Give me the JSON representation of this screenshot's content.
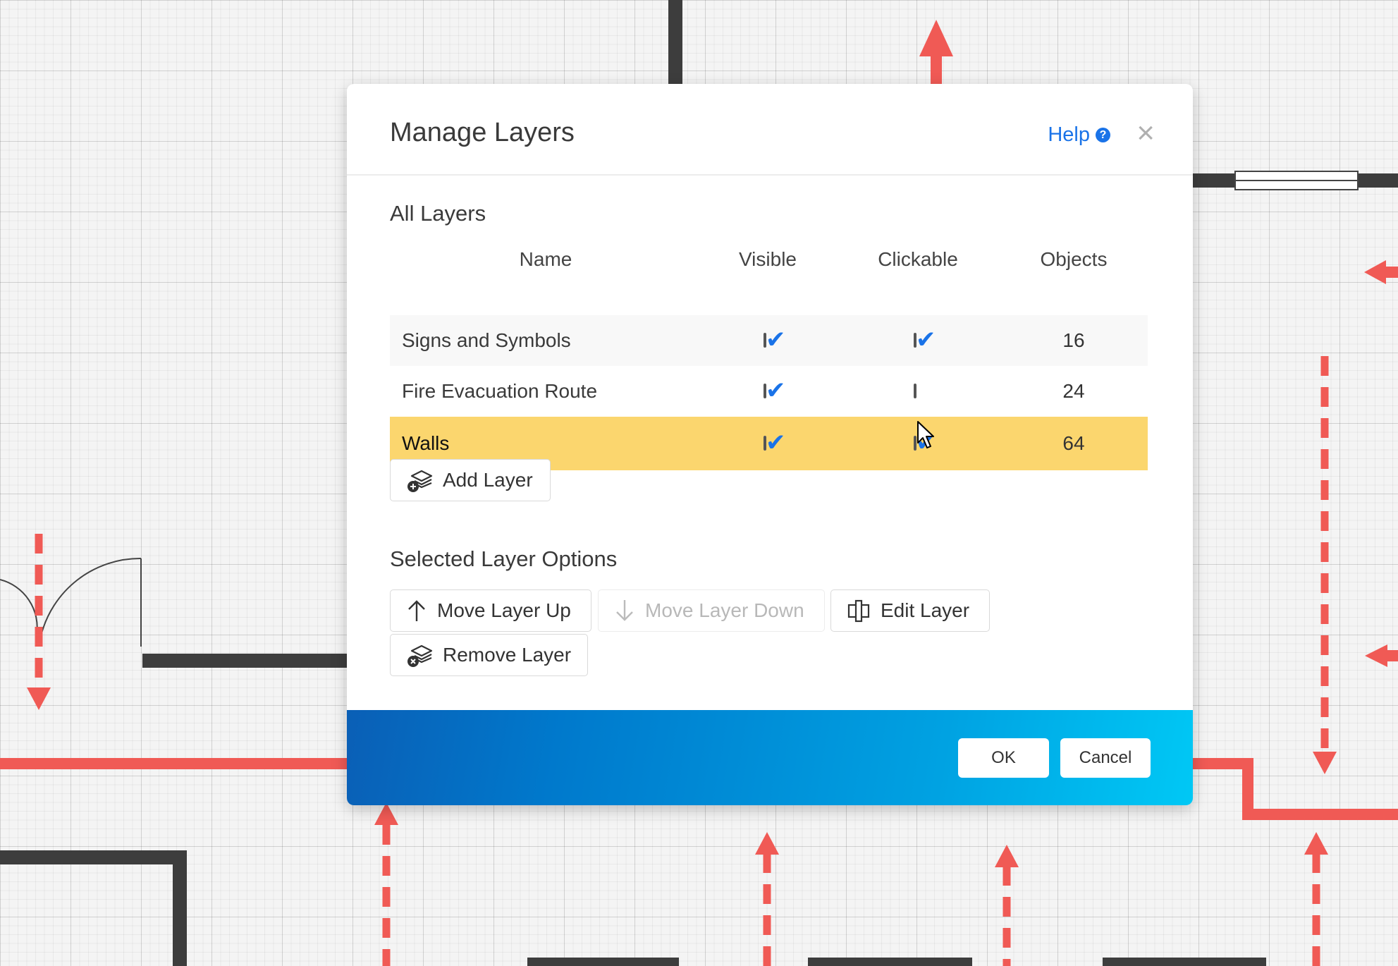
{
  "dialog": {
    "title": "Manage Layers",
    "help_label": "Help",
    "close_symbol": "×"
  },
  "all_layers": {
    "heading": "All Layers",
    "columns": [
      "Name",
      "Visible",
      "Clickable",
      "Objects"
    ],
    "rows": [
      {
        "name": "Signs and Symbols",
        "visible": true,
        "clickable": true,
        "objects": "16",
        "selected": false
      },
      {
        "name": "Fire Evacuation Route",
        "visible": true,
        "clickable": false,
        "objects": "24",
        "selected": false
      },
      {
        "name": "Walls",
        "visible": true,
        "clickable": true,
        "objects": "64",
        "selected": true
      }
    ],
    "add_layer_label": "Add Layer"
  },
  "selected_options": {
    "heading": "Selected Layer Options",
    "move_up_label": "Move Layer Up",
    "move_down_label": "Move Layer Down",
    "edit_label": "Edit Layer",
    "remove_label": "Remove Layer"
  },
  "footer": {
    "ok_label": "OK",
    "cancel_label": "Cancel"
  },
  "colors": {
    "accent": "#1a73e8",
    "selected_row": "#fbd66e",
    "route_red": "#f05a55",
    "wall_dark": "#3d3d3d"
  },
  "icons": [
    "help-icon",
    "close-icon",
    "add-layer-icon",
    "arrow-up-icon",
    "arrow-down-icon",
    "edit-layer-icon",
    "remove-layer-icon",
    "checkmark-icon",
    "mouse-pointer-icon"
  ]
}
